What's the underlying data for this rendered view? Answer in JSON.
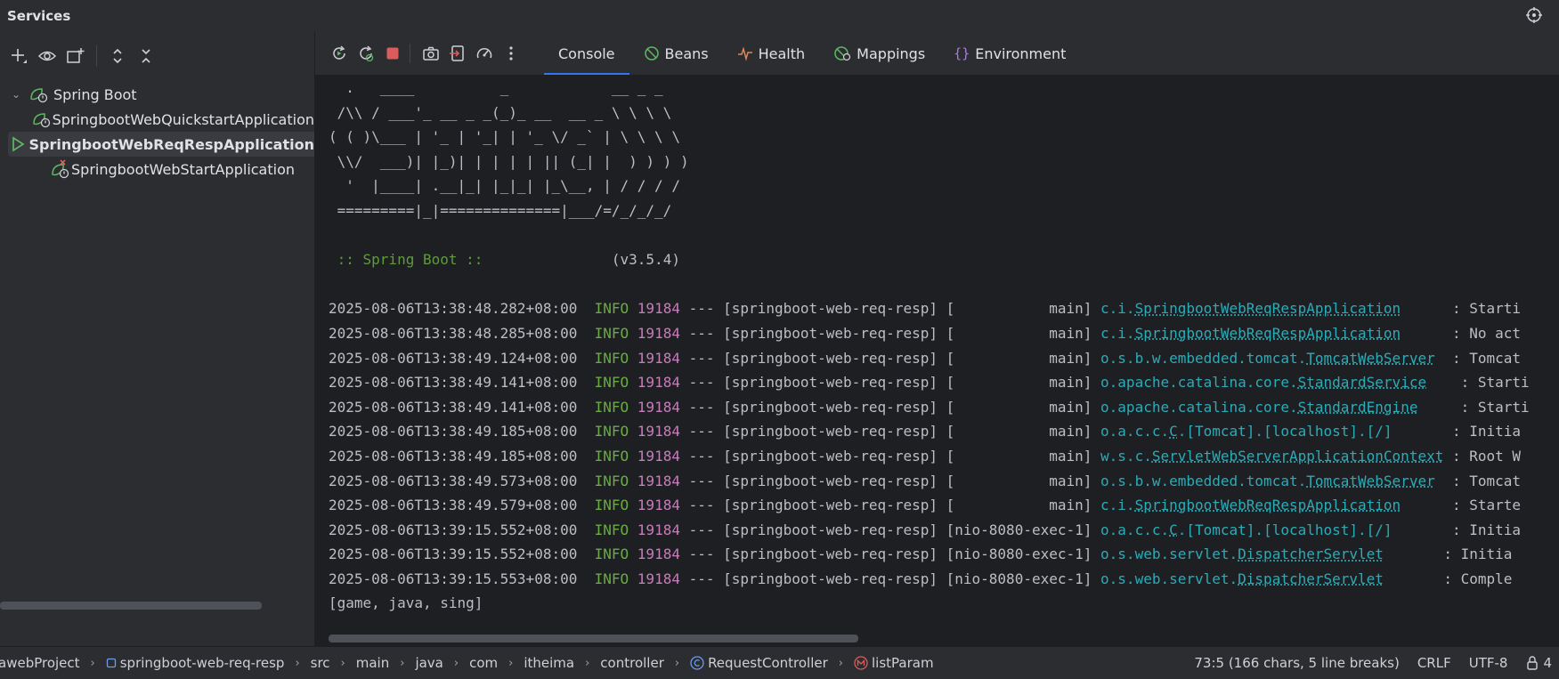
{
  "window": {
    "title": "Services"
  },
  "tree": {
    "root": {
      "label": "Spring Boot"
    },
    "items": [
      {
        "label": "SpringbootWebQuickstartApplication",
        "state": "stopped"
      },
      {
        "label": "SpringbootWebReqRespApplication",
        "state": "running"
      },
      {
        "label": "SpringbootWebStartApplication",
        "state": "error"
      }
    ]
  },
  "tabs": [
    {
      "label": "Console",
      "icon": "none"
    },
    {
      "label": "Beans",
      "icon": "beans-icon"
    },
    {
      "label": "Health",
      "icon": "health-icon"
    },
    {
      "label": "Mappings",
      "icon": "mappings-icon"
    },
    {
      "label": "Environment",
      "icon": "environment-icon"
    }
  ],
  "console": {
    "banner": [
      "  .   ____          _            __ _ _",
      " /\\\\ / ___'_ __ _ _(_)_ __  __ _ \\ \\ \\ \\",
      "( ( )\\___ | '_ | '_| | '_ \\/ _` | \\ \\ \\ \\",
      " \\\\/  ___)| |_)| | | | | || (_| |  ) ) ) )",
      "  '  |____| .__|_| |_|_| |_\\__, | / / / /",
      " =========|_|==============|___/=/_/_/_/"
    ],
    "spring_label": " :: Spring Boot :: ",
    "spring_version": "              (v3.5.4)",
    "logs": [
      {
        "ts": "2025-08-06T13:38:48.282+08:00",
        "level": "INFO",
        "pid": "19184",
        "sep": "---",
        "app": "[springboot-web-req-resp]",
        "thread": "[           main]",
        "logger_prefix": "c.i.",
        "logger_class": "SpringbootWebReqRespApplication",
        "pad": "      ",
        "msg": ": Starti"
      },
      {
        "ts": "2025-08-06T13:38:48.285+08:00",
        "level": "INFO",
        "pid": "19184",
        "sep": "---",
        "app": "[springboot-web-req-resp]",
        "thread": "[           main]",
        "logger_prefix": "c.i.",
        "logger_class": "SpringbootWebReqRespApplication",
        "pad": "      ",
        "msg": ": No act"
      },
      {
        "ts": "2025-08-06T13:38:49.124+08:00",
        "level": "INFO",
        "pid": "19184",
        "sep": "---",
        "app": "[springboot-web-req-resp]",
        "thread": "[           main]",
        "logger_prefix": "o.s.b.w.embedded.tomcat.",
        "logger_class": "TomcatWebServer",
        "pad": "  ",
        "msg": ": Tomcat"
      },
      {
        "ts": "2025-08-06T13:38:49.141+08:00",
        "level": "INFO",
        "pid": "19184",
        "sep": "---",
        "app": "[springboot-web-req-resp]",
        "thread": "[           main]",
        "logger_prefix": "o.apache.catalina.core.",
        "logger_class": "StandardService",
        "pad": "    ",
        "msg": ": Starti"
      },
      {
        "ts": "2025-08-06T13:38:49.141+08:00",
        "level": "INFO",
        "pid": "19184",
        "sep": "---",
        "app": "[springboot-web-req-resp]",
        "thread": "[           main]",
        "logger_prefix": "o.apache.catalina.core.",
        "logger_class": "StandardEngine",
        "pad": "     ",
        "msg": ": Starti"
      },
      {
        "ts": "2025-08-06T13:38:49.185+08:00",
        "level": "INFO",
        "pid": "19184",
        "sep": "---",
        "app": "[springboot-web-req-resp]",
        "thread": "[           main]",
        "logger_prefix": "o.a.c.c.",
        "logger_class": "C",
        "logger_suffix": ".[Tomcat].[localhost].[/]",
        "pad": "       ",
        "msg": ": Initia"
      },
      {
        "ts": "2025-08-06T13:38:49.185+08:00",
        "level": "INFO",
        "pid": "19184",
        "sep": "---",
        "app": "[springboot-web-req-resp]",
        "thread": "[           main]",
        "logger_prefix": "w.s.c.",
        "logger_class": "ServletWebServerApplicationContext",
        "pad": " ",
        "msg": ": Root W"
      },
      {
        "ts": "2025-08-06T13:38:49.573+08:00",
        "level": "INFO",
        "pid": "19184",
        "sep": "---",
        "app": "[springboot-web-req-resp]",
        "thread": "[           main]",
        "logger_prefix": "o.s.b.w.embedded.tomcat.",
        "logger_class": "TomcatWebServer",
        "pad": "  ",
        "msg": ": Tomcat"
      },
      {
        "ts": "2025-08-06T13:38:49.579+08:00",
        "level": "INFO",
        "pid": "19184",
        "sep": "---",
        "app": "[springboot-web-req-resp]",
        "thread": "[           main]",
        "logger_prefix": "c.i.",
        "logger_class": "SpringbootWebReqRespApplication",
        "pad": "      ",
        "msg": ": Starte"
      },
      {
        "ts": "2025-08-06T13:39:15.552+08:00",
        "level": "INFO",
        "pid": "19184",
        "sep": "---",
        "app": "[springboot-web-req-resp]",
        "thread": "[nio-8080-exec-1]",
        "logger_prefix": "o.a.c.c.",
        "logger_class": "C",
        "logger_suffix": ".[Tomcat].[localhost].[/]",
        "pad": "       ",
        "msg": ": Initia"
      },
      {
        "ts": "2025-08-06T13:39:15.552+08:00",
        "level": "INFO",
        "pid": "19184",
        "sep": "---",
        "app": "[springboot-web-req-resp]",
        "thread": "[nio-8080-exec-1]",
        "logger_prefix": "o.s.web.servlet.",
        "logger_class": "DispatcherServlet",
        "pad": "       ",
        "msg": ": Initia"
      },
      {
        "ts": "2025-08-06T13:39:15.553+08:00",
        "level": "INFO",
        "pid": "19184",
        "sep": "---",
        "app": "[springboot-web-req-resp]",
        "thread": "[nio-8080-exec-1]",
        "logger_prefix": "o.s.web.servlet.",
        "logger_class": "DispatcherServlet",
        "pad": "       ",
        "msg": ": Comple"
      }
    ],
    "output": "[game, java, sing]"
  },
  "statusbar": {
    "breadcrumbs": [
      {
        "label": "awebProject",
        "icon": "none"
      },
      {
        "label": "springboot-web-req-resp",
        "icon": "module-icon"
      },
      {
        "label": "src",
        "icon": "none"
      },
      {
        "label": "main",
        "icon": "none"
      },
      {
        "label": "java",
        "icon": "none"
      },
      {
        "label": "com",
        "icon": "none"
      },
      {
        "label": "itheima",
        "icon": "none"
      },
      {
        "label": "controller",
        "icon": "none"
      },
      {
        "label": "RequestController",
        "icon": "class-icon"
      },
      {
        "label": "listParam",
        "icon": "method-icon"
      }
    ],
    "position": "73:5 (166 chars, 5 line breaks)",
    "line_ending": "CRLF",
    "encoding": "UTF-8",
    "notifications": "4"
  },
  "colors": {
    "accent": "#3574f0",
    "stop_red": "#db5c5c",
    "run_green": "#5fb865",
    "log_level": "#6aab45",
    "pid": "#c77dbb",
    "logger": "#2aacb8"
  }
}
